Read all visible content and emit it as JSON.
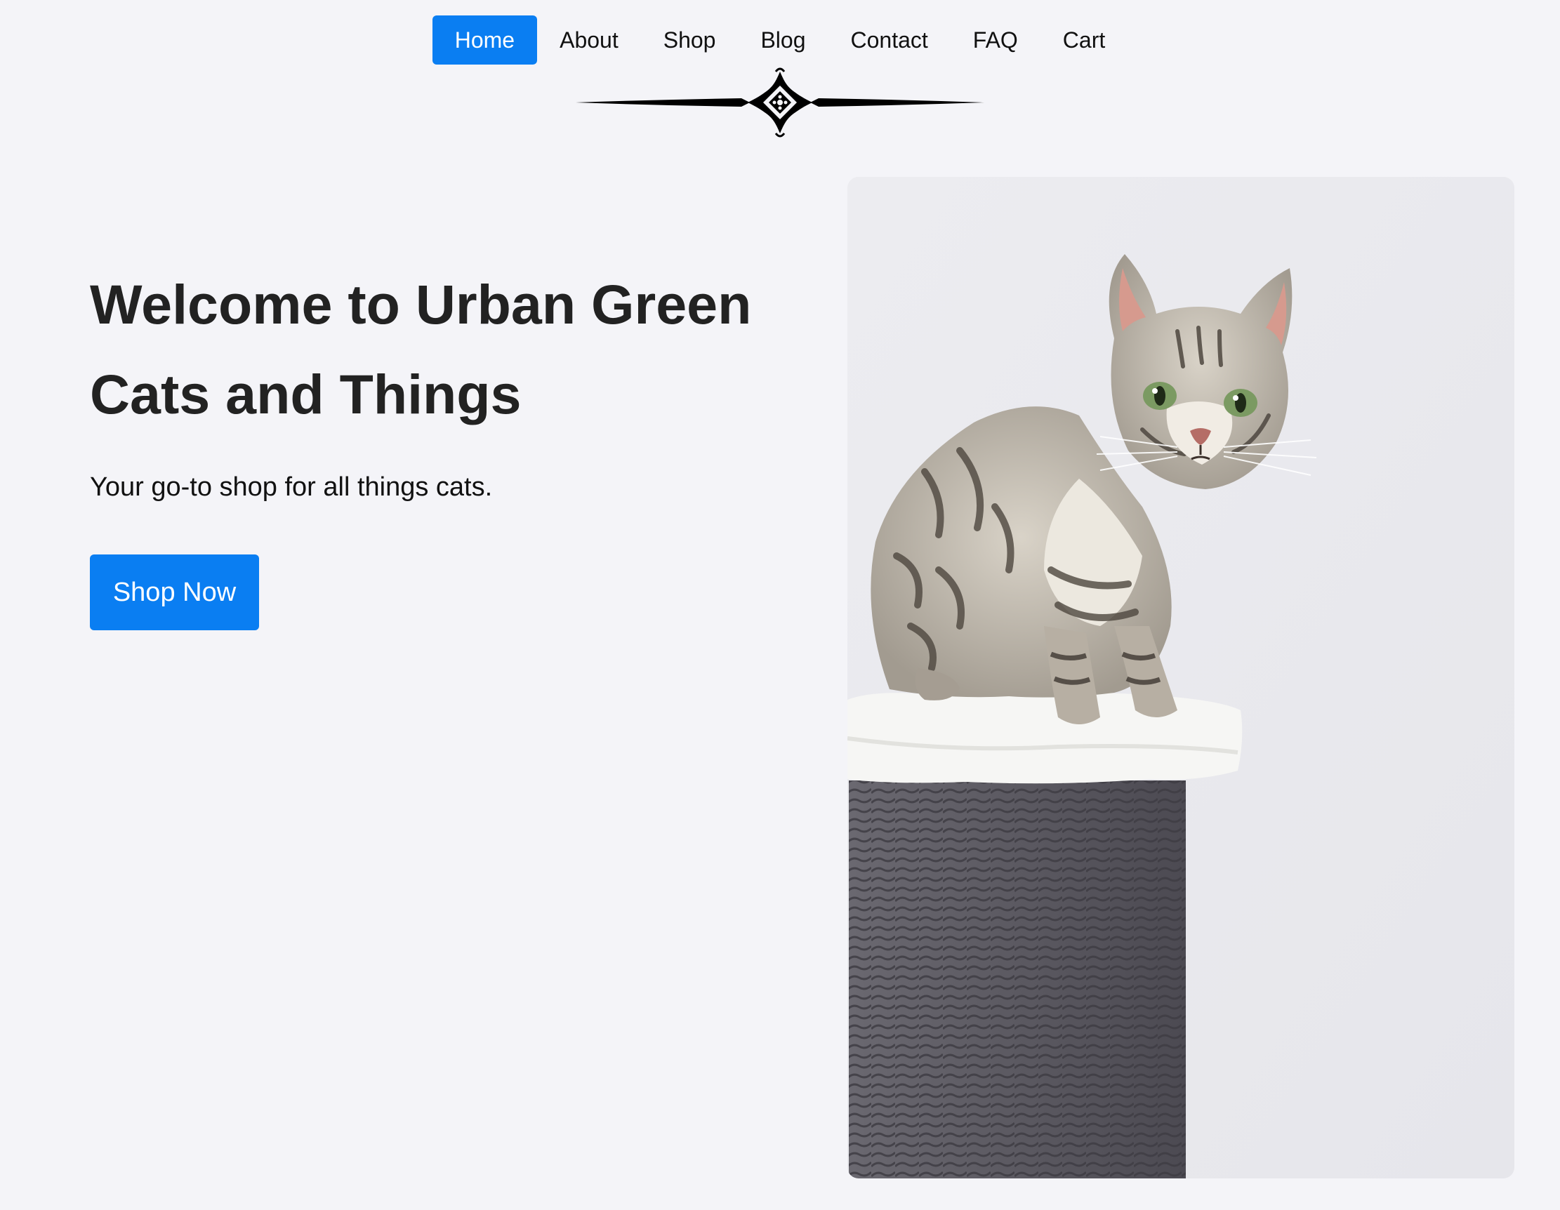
{
  "nav": {
    "items": [
      {
        "label": "Home",
        "active": true
      },
      {
        "label": "About",
        "active": false
      },
      {
        "label": "Shop",
        "active": false
      },
      {
        "label": "Blog",
        "active": false
      },
      {
        "label": "Contact",
        "active": false
      },
      {
        "label": "FAQ",
        "active": false
      },
      {
        "label": "Cart",
        "active": false
      }
    ]
  },
  "divider": {
    "icon": "ornamental-divider-icon"
  },
  "hero": {
    "title": "Welcome to Urban Green Cats and Things",
    "subtitle": "Your go-to shop for all things cats.",
    "cta_label": "Shop Now"
  },
  "image": {
    "subject": "cat-on-scratching-post-photo"
  },
  "colors": {
    "accent": "#0a7ef2",
    "background": "#f4f4f8",
    "text": "#222222"
  }
}
